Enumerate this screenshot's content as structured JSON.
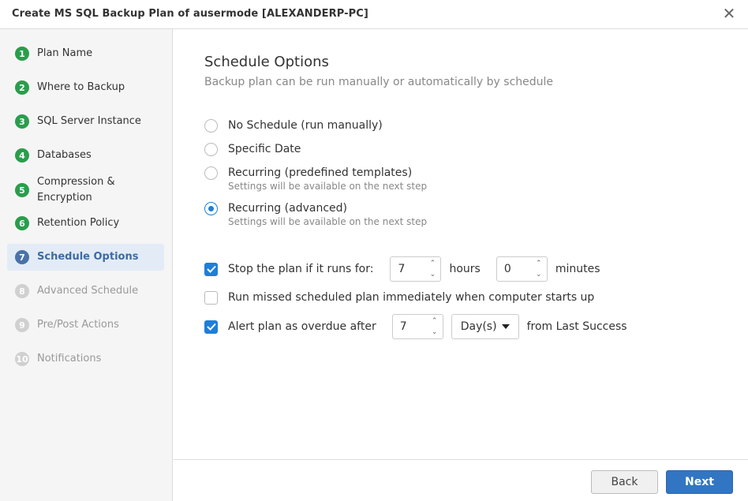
{
  "window": {
    "title": "Create MS SQL Backup Plan of ausermode [ALEXANDERP-PC]",
    "close_glyph": "✕"
  },
  "sidebar": {
    "steps": [
      {
        "num": "1",
        "label": "Plan Name",
        "state": "done"
      },
      {
        "num": "2",
        "label": "Where to Backup",
        "state": "done"
      },
      {
        "num": "3",
        "label": "SQL Server Instance",
        "state": "done"
      },
      {
        "num": "4",
        "label": "Databases",
        "state": "done"
      },
      {
        "num": "5",
        "label": "Compression & Encryption",
        "state": "done"
      },
      {
        "num": "6",
        "label": "Retention Policy",
        "state": "done"
      },
      {
        "num": "7",
        "label": "Schedule Options",
        "state": "active"
      },
      {
        "num": "8",
        "label": "Advanced Schedule",
        "state": "future"
      },
      {
        "num": "9",
        "label": "Pre/Post Actions",
        "state": "future"
      },
      {
        "num": "10",
        "label": "Notifications",
        "state": "future"
      }
    ]
  },
  "content": {
    "heading": "Schedule Options",
    "subheading": "Backup plan can be run manually or automatically by schedule",
    "schedule_modes": [
      {
        "label": "No Schedule (run manually)",
        "hint": "",
        "selected": false
      },
      {
        "label": "Specific Date",
        "hint": "",
        "selected": false
      },
      {
        "label": "Recurring (predefined templates)",
        "hint": "Settings will be available on the next step",
        "selected": false
      },
      {
        "label": "Recurring (advanced)",
        "hint": "Settings will be available on the next step",
        "selected": true
      }
    ],
    "stop_plan": {
      "checked": true,
      "label": "Stop the plan if it runs for:",
      "hours_value": "7",
      "hours_label": "hours",
      "minutes_value": "0",
      "minutes_label": "minutes"
    },
    "run_missed": {
      "checked": false,
      "label": "Run missed scheduled plan immediately when computer starts up"
    },
    "alert_overdue": {
      "checked": true,
      "label": "Alert plan as overdue after",
      "value": "7",
      "unit": "Day(s)",
      "suffix": "from Last Success"
    },
    "spin_up": "⌃",
    "spin_down": "⌄"
  },
  "footer": {
    "back_label": "Back",
    "next_label": "Next"
  },
  "colors": {
    "accent": "#1e7fd8",
    "done_step": "#2a9d4c",
    "active_step": "#4a72a8",
    "primary_button": "#3276c3"
  }
}
